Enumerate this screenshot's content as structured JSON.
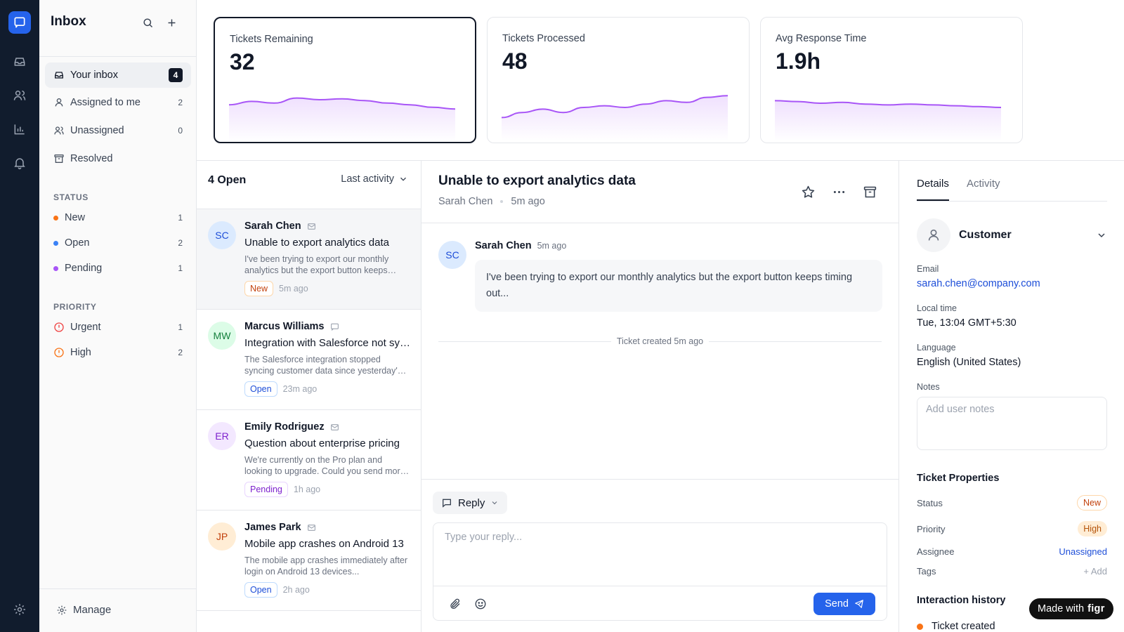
{
  "sidebar": {
    "title": "Inbox",
    "nav": [
      {
        "label": "Your inbox",
        "count": "4",
        "icon": "inbox-icon",
        "active": true
      },
      {
        "label": "Assigned to me",
        "count": "2",
        "icon": "user-icon"
      },
      {
        "label": "Unassigned",
        "count": "0",
        "icon": "users-icon"
      },
      {
        "label": "Resolved",
        "count": "",
        "icon": "archive-icon"
      }
    ],
    "status_title": "STATUS",
    "statuses": [
      {
        "label": "New",
        "count": "1",
        "color": "#f97316"
      },
      {
        "label": "Open",
        "count": "2",
        "color": "#3b82f6"
      },
      {
        "label": "Pending",
        "count": "1",
        "color": "#a855f7"
      }
    ],
    "priority_title": "PRIORITY",
    "priorities": [
      {
        "label": "Urgent",
        "count": "1",
        "color": "#ef4444"
      },
      {
        "label": "High",
        "count": "2",
        "color": "#f97316"
      }
    ],
    "manage_label": "Manage"
  },
  "stats": [
    {
      "label": "Tickets Remaining",
      "value": "32",
      "trend": [
        22,
        24,
        23,
        26,
        25,
        25.5,
        24.5,
        23,
        22,
        20.5,
        19.5
      ],
      "color": "#a855f7"
    },
    {
      "label": "Tickets Processed",
      "value": "48",
      "trend": [
        14,
        17,
        19,
        17,
        20,
        21,
        20,
        22,
        24,
        23,
        26,
        27
      ],
      "color": "#a855f7"
    },
    {
      "label": "Avg Response Time",
      "value": "1.9h",
      "trend": [
        24,
        23.5,
        22.5,
        23,
        22,
        21.5,
        22,
        21.5,
        21,
        20.5,
        20
      ],
      "color": "#a855f7"
    }
  ],
  "ticket_list": {
    "count_label": "4 Open",
    "sort_label": "Last activity",
    "tickets": [
      {
        "initials": "SC",
        "name": "Sarah Chen",
        "channel": "email",
        "subject": "Unable to export analytics data",
        "preview": "I've been trying to export our monthly analytics but the export button keeps timing out...",
        "status": "New",
        "status_key": "new",
        "time": "5m ago",
        "avatar_bg": "#dbeafe",
        "avatar_fg": "#1d4ed8",
        "selected": true
      },
      {
        "initials": "MW",
        "name": "Marcus Williams",
        "channel": "chat",
        "subject": "Integration with Salesforce not syncing",
        "preview": "The Salesforce integration stopped syncing customer data since yesterday's update...",
        "status": "Open",
        "status_key": "open",
        "time": "23m ago",
        "avatar_bg": "#dcfce7",
        "avatar_fg": "#15803d"
      },
      {
        "initials": "ER",
        "name": "Emily Rodriguez",
        "channel": "email",
        "subject": "Question about enterprise pricing",
        "preview": "We're currently on the Pro plan and looking to upgrade. Could you send more details...",
        "status": "Pending",
        "status_key": "pending",
        "time": "1h ago",
        "avatar_bg": "#f3e8ff",
        "avatar_fg": "#7e22ce"
      },
      {
        "initials": "JP",
        "name": "James Park",
        "channel": "email",
        "subject": "Mobile app crashes on Android 13",
        "preview": "The mobile app crashes immediately after login on Android 13 devices...",
        "status": "Open",
        "status_key": "open",
        "time": "2h ago",
        "avatar_bg": "#ffedd5",
        "avatar_fg": "#c2410c"
      }
    ]
  },
  "conversation": {
    "title": "Unable to export analytics data",
    "customer": "Sarah Chen",
    "time": "5m ago",
    "message": {
      "initials": "SC",
      "author": "Sarah Chen",
      "time": "5m ago",
      "body": "I've been trying to export our monthly analytics but the export button keeps timing out..."
    },
    "system_event": "Ticket created 5m ago",
    "reply_mode": "Reply",
    "reply_placeholder": "Type your reply...",
    "send_label": "Send"
  },
  "details": {
    "tabs": [
      "Details",
      "Activity"
    ],
    "customer_label": "Customer",
    "email_label": "Email",
    "email": "sarah.chen@company.com",
    "local_time_label": "Local time",
    "local_time": "Tue, 13:04 GMT+5:30",
    "language_label": "Language",
    "language": "English (United States)",
    "notes_label": "Notes",
    "notes_placeholder": "Add user notes",
    "properties_title": "Ticket Properties",
    "status_label": "Status",
    "status": "New",
    "priority_label": "Priority",
    "priority": "High",
    "assignee_label": "Assignee",
    "assignee": "Unassigned",
    "tags_label": "Tags",
    "tags_add": "+ Add",
    "history_title": "Interaction history",
    "history_first": "Ticket created"
  },
  "badge": {
    "prefix": "Made with",
    "brand": "figr"
  }
}
